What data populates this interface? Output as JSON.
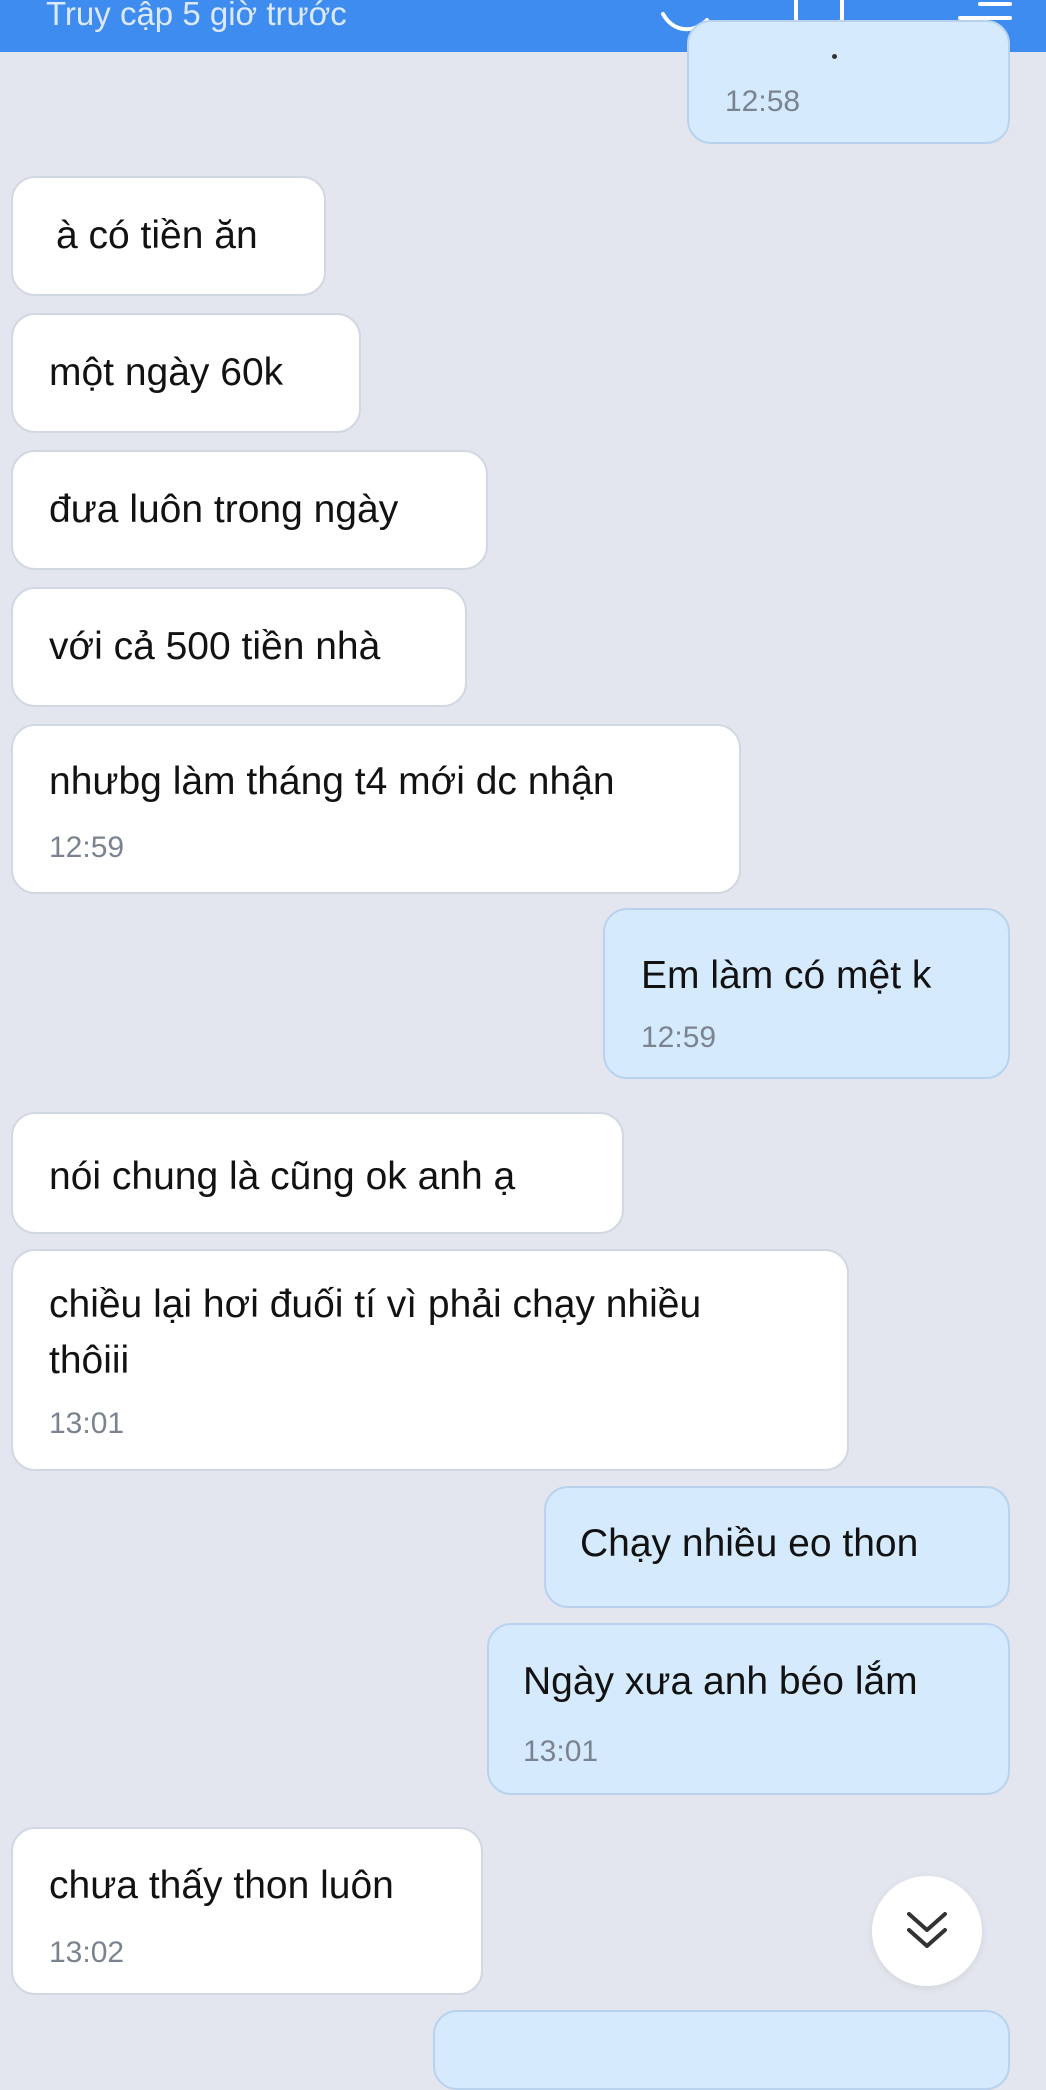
{
  "header": {
    "status_text": "Truy cập 5 giờ trước"
  },
  "messages": [
    {
      "dir": "out",
      "text": "",
      "time": "12:58"
    },
    {
      "dir": "in",
      "text": "à có tiền ăn",
      "time": ""
    },
    {
      "dir": "in",
      "text": "một ngày 60k",
      "time": ""
    },
    {
      "dir": "in",
      "text": "đưa luôn trong ngày",
      "time": ""
    },
    {
      "dir": "in",
      "text": "với cả 500 tiền nhà",
      "time": ""
    },
    {
      "dir": "in",
      "text": "nhưbg làm tháng t4 mới dc nhận",
      "time": "12:59"
    },
    {
      "dir": "out",
      "text": "Em làm có mệt k",
      "time": "12:59"
    },
    {
      "dir": "in",
      "text": "nói chung là cũng ok anh ạ",
      "time": ""
    },
    {
      "dir": "in",
      "text": "chiều lại hơi đuối tí vì phải chạy nhiều",
      "text2": "thôiii",
      "time": "13:01"
    },
    {
      "dir": "out",
      "text": "Chạy nhiều eo thon",
      "time": ""
    },
    {
      "dir": "out",
      "text": "Ngày xưa anh béo lắm",
      "time": "13:01"
    },
    {
      "dir": "in",
      "text": "chưa thấy thon luôn",
      "time": "13:02"
    }
  ],
  "icons": {
    "phone": "phone-icon",
    "video": "video-call-icon",
    "menu": "menu-icon",
    "scroll_down": "double-chevron-down-icon"
  },
  "colors": {
    "header": "#3f8cf0",
    "background": "#e3e6ee",
    "incoming_bubble": "#ffffff",
    "outgoing_bubble": "#d5ebfd"
  }
}
